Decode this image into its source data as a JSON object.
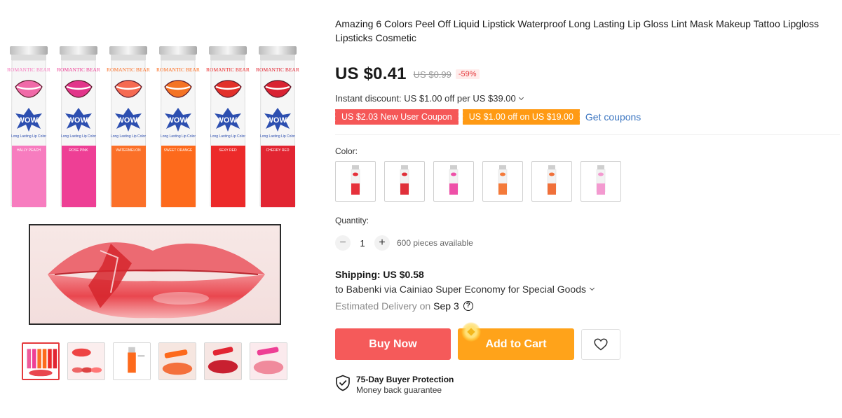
{
  "product": {
    "title": "Amazing 6 Colors Peel Off Liquid Lipstick Waterproof Long Lasting Lip Gloss Lint Mask Makeup Tattoo Lipgloss Lipsticks Cosmetic",
    "price": "US $0.41",
    "original_price": "US $0.99",
    "discount": "-59%"
  },
  "gallery": {
    "tube_brand": "ROMANTIC BEAR",
    "tube_wow": "WOW!",
    "tube_subtitle": "Long Lasting Lip Color",
    "tubes": [
      {
        "shade": "HALLY PEACH",
        "color": "#f77cbf",
        "lips": "#f06aa8"
      },
      {
        "shade": "ROSE PINK",
        "color": "#ee3f95",
        "lips": "#e2358a"
      },
      {
        "shade": "WATERMELON",
        "color": "#fb7028",
        "lips": "#f56a52"
      },
      {
        "shade": "SWEET ORANGE",
        "color": "#fd6a1c",
        "lips": "#f47324"
      },
      {
        "shade": "SEXY RED",
        "color": "#ec2a2a",
        "lips": "#e2302a"
      },
      {
        "shade": "CHERRY RED",
        "color": "#e22532",
        "lips": "#d92232"
      }
    ],
    "thumbnails": [
      "lipstick-set",
      "lips-swatches",
      "single-tube",
      "orange-lips",
      "red-lips",
      "pink-lips"
    ]
  },
  "pricing": {
    "instant_discount": "Instant discount: US $1.00 off per US $39.00",
    "coupon_new_user": "US $2.03 New User Coupon",
    "coupon_off": "US $1.00 off on US $19.00",
    "get_coupons": "Get coupons"
  },
  "options": {
    "color_label": "Color:",
    "swatch_colors": [
      "#e6313b",
      "#e0303a",
      "#ee50a8",
      "#f47a3a",
      "#f0703a",
      "#f39ad0"
    ]
  },
  "quantity": {
    "label": "Quantity:",
    "minus": "−",
    "plus": "+",
    "value": "1",
    "available": "600 pieces available"
  },
  "shipping": {
    "title": "Shipping: US $0.58",
    "route": "to Babenki via Cainiao Super Economy for Special Goods",
    "estimated_label": "Estimated Delivery on",
    "date": "Sep 3",
    "help": "?"
  },
  "actions": {
    "buy_now": "Buy Now",
    "add_to_cart": "Add to Cart"
  },
  "protection": {
    "title": "75-Day Buyer Protection",
    "subtitle": "Money back guarantee"
  },
  "colors": {
    "accent_red": "#f55a5a",
    "accent_orange": "#ffa31a",
    "link_blue": "#3c76c1",
    "discount_red": "#e4393c"
  }
}
